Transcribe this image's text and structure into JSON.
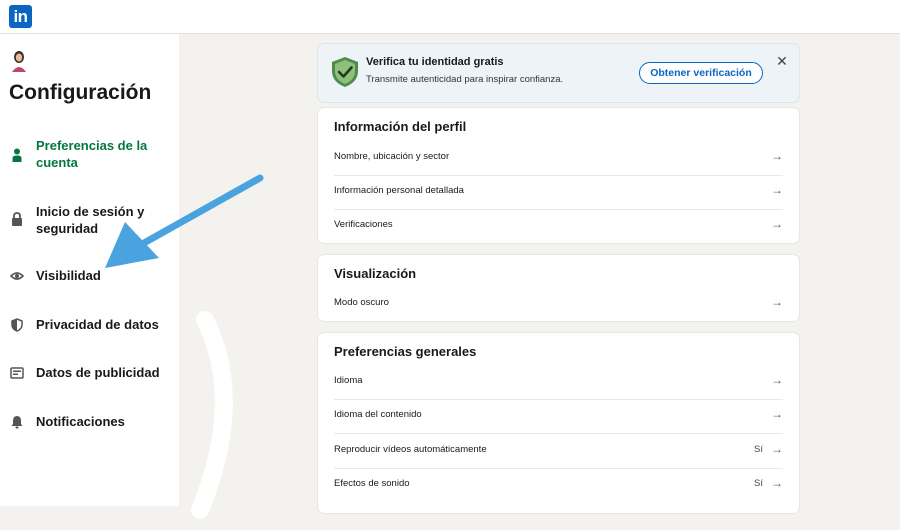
{
  "header": {
    "logo_text": "in"
  },
  "sidebar": {
    "title": "Configuración",
    "items": [
      {
        "label": "Preferencias de la cuenta",
        "icon": "person-icon",
        "active": true
      },
      {
        "label": "Inicio de sesión y seguridad",
        "icon": "lock-icon",
        "active": false
      },
      {
        "label": "Visibilidad",
        "icon": "eye-icon",
        "active": false
      },
      {
        "label": "Privacidad de datos",
        "icon": "shield-icon",
        "active": false
      },
      {
        "label": "Datos de publicidad",
        "icon": "newspaper-icon",
        "active": false
      },
      {
        "label": "Notificaciones",
        "icon": "bell-icon",
        "active": false
      }
    ]
  },
  "verification": {
    "title": "Verifica tu identidad gratis",
    "subtitle": "Transmite autenticidad para inspirar confianza.",
    "button": "Obtener verificación",
    "close": "✕"
  },
  "sections": [
    {
      "title": "Información del perfil",
      "rows": [
        {
          "label": "Nombre, ubicación y sector",
          "value": ""
        },
        {
          "label": "Información personal detallada",
          "value": ""
        },
        {
          "label": "Verificaciones",
          "value": ""
        }
      ]
    },
    {
      "title": "Visualización",
      "rows": [
        {
          "label": "Modo oscuro",
          "value": ""
        }
      ]
    },
    {
      "title": "Preferencias generales",
      "rows": [
        {
          "label": "Idioma",
          "value": ""
        },
        {
          "label": "Idioma del contenido",
          "value": ""
        },
        {
          "label": "Reproducir vídeos automáticamente",
          "value": "Sí"
        },
        {
          "label": "Efectos de sonido",
          "value": "Sí"
        }
      ]
    }
  ],
  "colors": {
    "accent": "#0a66c2",
    "active_nav": "#057642",
    "annotation_arrow": "#4aa3df"
  },
  "arrow_glyph": "→"
}
